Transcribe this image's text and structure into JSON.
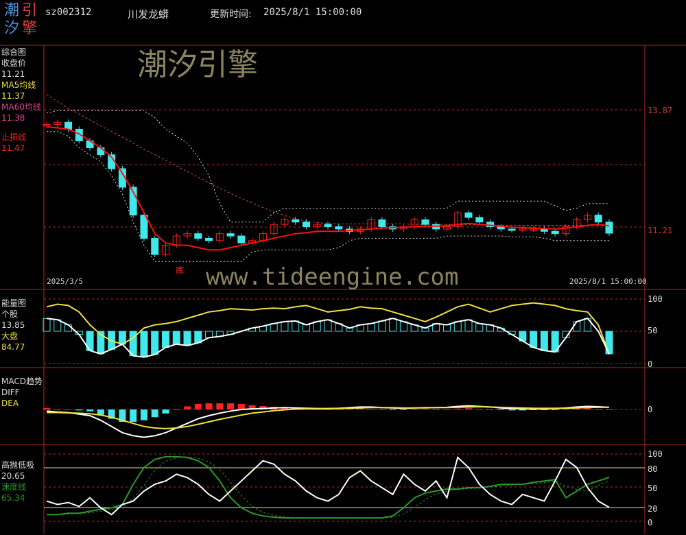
{
  "header": {
    "code": "sz002312",
    "name": "川发龙蟒",
    "update_label": "更新时间:",
    "update_time": "2025/8/1 15:00:00"
  },
  "logo": {
    "chars": [
      "潮",
      "引",
      "汐",
      "擎"
    ],
    "colors": [
      "#4a90d9",
      "#e04040",
      "#4a90d9",
      "#e04040"
    ]
  },
  "watermarks": {
    "cn": "潮汐引擎",
    "url": "www.tideengine.com"
  },
  "panel_main": {
    "title": "综合图",
    "close_label": "收盘价",
    "close_value": "11.21",
    "ma5_label": "MA5均线",
    "ma5_value": "11.37",
    "ma60_label": "MA60均线",
    "ma60_value": "11.38",
    "stop_label": "止损线",
    "stop_value": "11.47",
    "price_high": "13.87",
    "price_last": "11.21",
    "date_start": "2025/3/5",
    "date_end": "2025/8/1 15:00:00",
    "bottom_mark": "底"
  },
  "panel_energy": {
    "title": "能量图",
    "stock_label": "个股",
    "stock_value": "13.85",
    "market_label": "大盘",
    "market_value": "84.77",
    "ticks": [
      "100",
      "50",
      "0"
    ]
  },
  "panel_macd": {
    "title": "MACD趋势",
    "diff_label": "DIFF",
    "dea_label": "DEA",
    "ticks": [
      "0"
    ]
  },
  "panel_kd": {
    "title": "高抛低吸",
    "value1": "20.65",
    "speed_label": "速度线",
    "speed_value": "65.34",
    "ticks": [
      "100",
      "80",
      "50",
      "20",
      "0"
    ]
  },
  "colors": {
    "up": "#ff2020",
    "down": "#40e8ec",
    "ma": "#ff1010",
    "ma60": "#d05050",
    "energy": "#f0e040",
    "white": "#ffffff",
    "speed": "#2a9a2a",
    "frame": "#c02020",
    "axis_red": "#e03030",
    "label_yellow": "#f0e040"
  },
  "chart_data": [
    {
      "type": "line",
      "title": "综合图",
      "ylim": [
        10.5,
        14.3
      ],
      "x": [
        "2025/3/5",
        "2025/8/1"
      ],
      "series": [
        {
          "name": "收盘价",
          "values": [
            13.55,
            13.6,
            13.45,
            13.2,
            13.05,
            12.9,
            12.6,
            12.2,
            11.6,
            11.1,
            10.75,
            10.95,
            11.15,
            11.2,
            11.1,
            11.05,
            11.2,
            11.15,
            11.0,
            11.05,
            11.2,
            11.4,
            11.5,
            11.45,
            11.35,
            11.4,
            11.35,
            11.3,
            11.25,
            11.3,
            11.5,
            11.35,
            11.3,
            11.35,
            11.5,
            11.4,
            11.3,
            11.35,
            11.65,
            11.55,
            11.45,
            11.35,
            11.3,
            11.28,
            11.3,
            11.3,
            11.25,
            11.2,
            11.35,
            11.5,
            11.6,
            11.45,
            11.21
          ]
        },
        {
          "name": "MA5均线",
          "values": [
            13.5,
            13.48,
            13.45,
            13.35,
            13.2,
            13.05,
            12.85,
            12.5,
            12.1,
            11.65,
            11.2,
            11.0,
            10.95,
            10.95,
            10.9,
            10.85,
            10.85,
            10.9,
            10.95,
            11.0,
            11.05,
            11.1,
            11.15,
            11.2,
            11.22,
            11.25,
            11.25,
            11.25,
            11.27,
            11.28,
            11.3,
            11.32,
            11.33,
            11.34,
            11.35,
            11.36,
            11.36,
            11.37,
            11.4,
            11.42,
            11.4,
            11.38,
            11.36,
            11.34,
            11.33,
            11.32,
            11.31,
            11.3,
            11.32,
            11.35,
            11.38,
            11.4,
            11.37
          ]
        },
        {
          "name": "MA60均线",
          "values": [
            14.2,
            14.05,
            13.9,
            13.78,
            13.65,
            13.52,
            13.4,
            13.28,
            13.15,
            13.02,
            12.9,
            12.78,
            12.66,
            12.54,
            12.42,
            12.3,
            12.18,
            12.07,
            11.96,
            11.86,
            11.76,
            11.67,
            11.59,
            11.52,
            11.47,
            11.44,
            11.42,
            11.41,
            11.41,
            11.41,
            11.41,
            11.41,
            11.41,
            11.41,
            11.4,
            11.4,
            11.4,
            11.4,
            11.39,
            11.39,
            11.39,
            11.39,
            11.38,
            11.38,
            11.38,
            11.38,
            11.38,
            11.38,
            11.38,
            11.38,
            11.38,
            11.38,
            11.38
          ]
        }
      ]
    },
    {
      "type": "bar",
      "title": "能量图",
      "ylim": [
        0,
        100
      ],
      "series": [
        {
          "name": "个股",
          "values": [
            88,
            92,
            90,
            80,
            60,
            45,
            35,
            30,
            40,
            55,
            60,
            62,
            65,
            70,
            75,
            80,
            82,
            85,
            84,
            83,
            85,
            86,
            85,
            88,
            90,
            85,
            80,
            82,
            84,
            88,
            86,
            85,
            80,
            75,
            70,
            65,
            72,
            80,
            88,
            92,
            86,
            80,
            85,
            90,
            92,
            94,
            92,
            90,
            85,
            82,
            80,
            60,
            14
          ]
        },
        {
          "name": "大盘",
          "values": [
            70,
            68,
            60,
            45,
            20,
            15,
            22,
            30,
            12,
            10,
            14,
            25,
            30,
            28,
            32,
            40,
            42,
            45,
            50,
            55,
            58,
            62,
            65,
            66,
            60,
            65,
            68,
            62,
            55,
            60,
            62,
            66,
            70,
            65,
            60,
            55,
            62,
            60,
            65,
            68,
            62,
            60,
            55,
            45,
            35,
            25,
            20,
            18,
            40,
            65,
            70,
            50,
            15
          ]
        }
      ]
    },
    {
      "type": "bar",
      "title": "MACD趋势",
      "series": [
        {
          "name": "DIFF",
          "values": [
            -0.05,
            -0.08,
            -0.1,
            -0.15,
            -0.2,
            -0.35,
            -0.55,
            -0.75,
            -0.85,
            -0.9,
            -0.85,
            -0.75,
            -0.6,
            -0.45,
            -0.3,
            -0.2,
            -0.12,
            -0.05,
            0.0,
            0.02,
            0.03,
            0.05,
            0.06,
            0.05,
            0.04,
            0.03,
            0.03,
            0.04,
            0.06,
            0.08,
            0.08,
            0.06,
            0.05,
            0.04,
            0.05,
            0.06,
            0.06,
            0.07,
            0.1,
            0.12,
            0.1,
            0.08,
            0.05,
            0.03,
            0.02,
            0.02,
            0.02,
            0.03,
            0.05,
            0.08,
            0.1,
            0.09,
            0.07
          ]
        },
        {
          "name": "DEA",
          "values": [
            -0.1,
            -0.1,
            -0.11,
            -0.12,
            -0.14,
            -0.18,
            -0.25,
            -0.35,
            -0.45,
            -0.55,
            -0.6,
            -0.62,
            -0.6,
            -0.55,
            -0.48,
            -0.4,
            -0.32,
            -0.25,
            -0.18,
            -0.12,
            -0.08,
            -0.04,
            -0.01,
            0.01,
            0.02,
            0.02,
            0.02,
            0.03,
            0.04,
            0.05,
            0.06,
            0.06,
            0.06,
            0.05,
            0.05,
            0.05,
            0.06,
            0.06,
            0.07,
            0.08,
            0.09,
            0.08,
            0.07,
            0.06,
            0.05,
            0.04,
            0.04,
            0.04,
            0.04,
            0.05,
            0.06,
            0.07,
            0.07
          ]
        }
      ]
    },
    {
      "type": "line",
      "title": "高抛低吸",
      "ylim": [
        0,
        100
      ],
      "series": [
        {
          "name": "高抛低吸",
          "values": [
            30,
            25,
            28,
            22,
            35,
            20,
            10,
            25,
            30,
            45,
            55,
            60,
            70,
            65,
            55,
            40,
            30,
            45,
            60,
            75,
            90,
            85,
            70,
            60,
            45,
            35,
            30,
            40,
            65,
            75,
            60,
            50,
            40,
            70,
            55,
            45,
            60,
            35,
            95,
            80,
            55,
            40,
            30,
            25,
            40,
            35,
            30,
            60,
            92,
            80,
            50,
            30,
            20.65
          ]
        },
        {
          "name": "速度线",
          "values": [
            10,
            10,
            12,
            12,
            15,
            18,
            20,
            25,
            55,
            80,
            92,
            96,
            96,
            95,
            90,
            80,
            60,
            35,
            20,
            12,
            8,
            6,
            5,
            5,
            5,
            5,
            5,
            5,
            5,
            5,
            5,
            5,
            8,
            20,
            35,
            42,
            45,
            48,
            48,
            50,
            50,
            52,
            55,
            55,
            55,
            58,
            60,
            62,
            35,
            45,
            55,
            60,
            65.34
          ]
        }
      ]
    }
  ]
}
